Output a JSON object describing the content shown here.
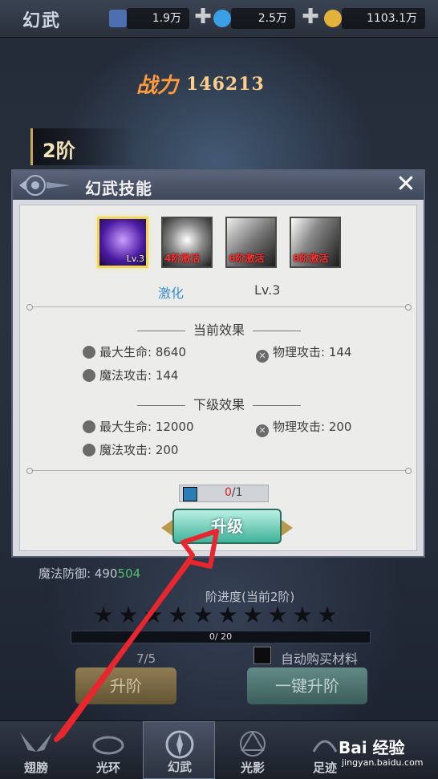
{
  "topbar": {
    "title": "幻武",
    "res1_value": "1.9万",
    "res2_value": "2.5万",
    "res3_value": "1103.1万"
  },
  "power": {
    "label": "战力",
    "value": "146213"
  },
  "stage": {
    "label": "2阶"
  },
  "dialog": {
    "title": "幻武技能",
    "skills": [
      {
        "tag": "Lv.3",
        "selected": true
      },
      {
        "tag": "4阶激活",
        "selected": false
      },
      {
        "tag": "6阶激活",
        "selected": false
      },
      {
        "tag": "8阶激活",
        "selected": false
      }
    ],
    "skill_name": "激化",
    "skill_level": "Lv.3",
    "current_title": "当前效果",
    "current": {
      "hp_label": "最大生命:",
      "hp_value": "8640",
      "phys_label": "物理攻击:",
      "phys_value": "144",
      "magic_label": "魔法攻击:",
      "magic_value": "144"
    },
    "next_title": "下级效果",
    "next": {
      "hp_label": "最大生命:",
      "hp_value": "12000",
      "phys_label": "物理攻击:",
      "phys_value": "200",
      "magic_label": "魔法攻击:",
      "magic_value": "200"
    },
    "material": {
      "have": "0",
      "need": "/1"
    },
    "upgrade_label": "升级"
  },
  "under": {
    "magic_def_label": "魔法防御:",
    "magic_def_value": "490",
    "magic_def_bonus": "504",
    "progress_title": "阶进度(当前2阶)",
    "progress_text": "0/ 20",
    "progress_fraction": 0,
    "stars_total": 10,
    "item_count": "7/5",
    "auto_buy_label": "自动购买材料",
    "upgrade_stage_label": "升阶",
    "oneclick_label": "一键升阶"
  },
  "nav": [
    {
      "label": "翅膀"
    },
    {
      "label": "光环"
    },
    {
      "label": "幻武"
    },
    {
      "label": "光影"
    },
    {
      "label": "足迹"
    }
  ],
  "watermark": {
    "brand": "Bai 经验",
    "url": "jingyan.baidu.com"
  },
  "colors": {
    "accent_red": "#e8262d",
    "upgrade_teal": "#3fb39b",
    "gold": "#f2d45a"
  }
}
